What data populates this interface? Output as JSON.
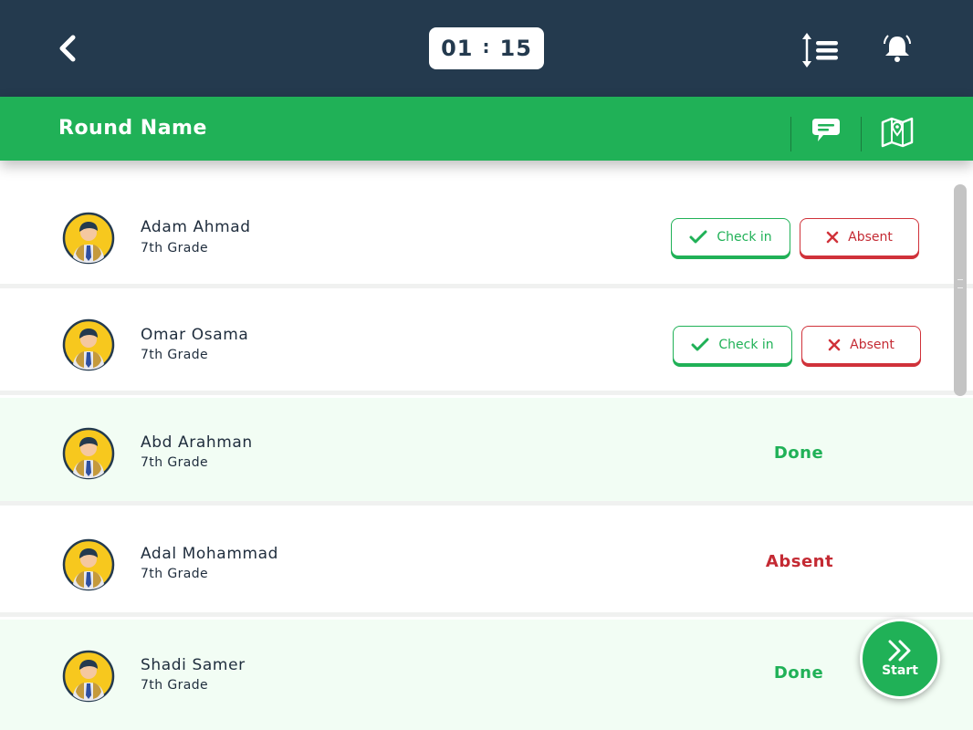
{
  "header": {
    "timer_minutes": "01",
    "timer_separator": ":",
    "timer_seconds": "15",
    "back_icon": "chevron-left-icon",
    "sort_icon": "sort-list-icon",
    "bell_icon": "bell-icon"
  },
  "round": {
    "title": "Round Name",
    "chat_icon": "chat-bubble-icon",
    "map_icon": "map-pin-icon"
  },
  "students": [
    {
      "name": "Adam Ahmad",
      "grade": "7th Grade",
      "state": "pending",
      "check_label": "Check in",
      "absent_label": "Absent"
    },
    {
      "name": "Omar Osama",
      "grade": "7th Grade",
      "state": "pending",
      "check_label": "Check in",
      "absent_label": "Absent"
    },
    {
      "name": "Abd Arahman",
      "grade": "7th Grade",
      "state": "done",
      "status_label": "Done"
    },
    {
      "name": "Adal Mohammad",
      "grade": "7th Grade",
      "state": "absent",
      "status_label": "Absent"
    },
    {
      "name": "Shadi Samer",
      "grade": "7th Grade",
      "state": "done",
      "status_label": "Done"
    }
  ],
  "start": {
    "label": "Start",
    "icon": "double-chevron-right-icon"
  },
  "colors": {
    "header": "#243a4e",
    "accent": "#20b157",
    "danger": "#c42a33",
    "done_row": "#f2fdf4"
  }
}
